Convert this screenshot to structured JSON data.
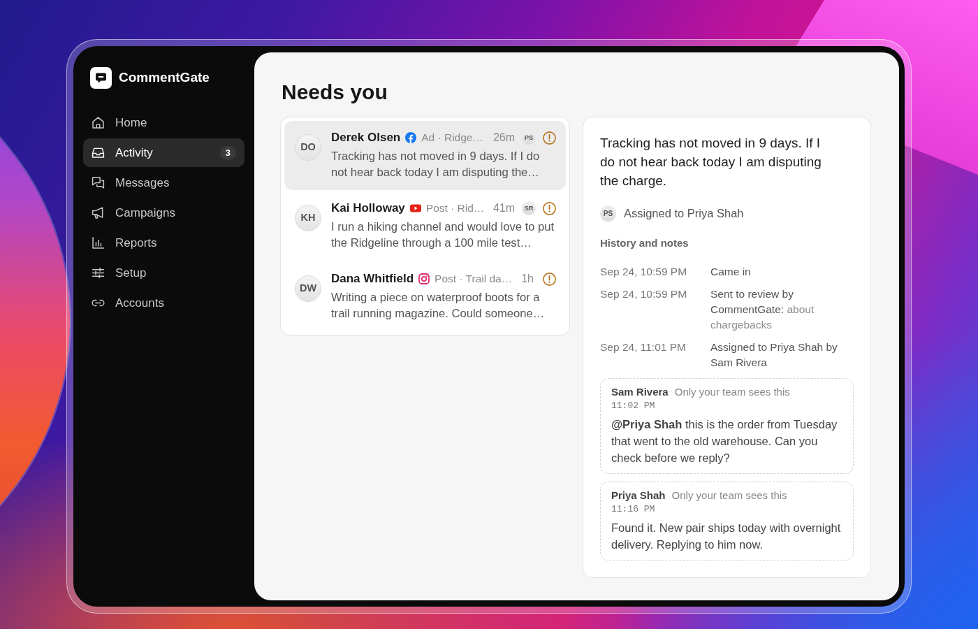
{
  "app": {
    "name": "CommentGate"
  },
  "sidebar": {
    "items": [
      {
        "label": "Home",
        "selected": false
      },
      {
        "label": "Activity",
        "selected": true,
        "badge": "3"
      },
      {
        "label": "Messages",
        "selected": false
      },
      {
        "label": "Campaigns",
        "selected": false
      },
      {
        "label": "Reports",
        "selected": false
      },
      {
        "label": "Setup",
        "selected": false
      },
      {
        "label": "Accounts",
        "selected": false
      }
    ]
  },
  "page": {
    "title": "Needs you"
  },
  "queue": [
    {
      "initials": "DO",
      "name": "Derek Olsen",
      "kind": "facebook",
      "meta": "Ad · Ridge…",
      "time": "26m",
      "assignee": "PS",
      "preview": "Tracking has not moved in 9 days. If I do not hear back today I am disputing the…",
      "selected": true
    },
    {
      "initials": "KH",
      "name": "Kai Holloway",
      "kind": "youtube",
      "meta": "Post · Rid…",
      "time": "41m",
      "assignee": "SR",
      "preview": "I run a hiking channel and would love to put the Ridgeline through a 100 mile test…",
      "selected": false
    },
    {
      "initials": "DW",
      "name": "Dana Whitfield",
      "kind": "instagram",
      "meta": "Post · Trail da…",
      "time": "1h",
      "preview": "Writing a piece on waterproof boots for a trail running magazine. Could someone…",
      "selected": false
    }
  ],
  "detail": {
    "message": "Tracking has not moved in 9 days. If I do not hear back today I am disputing the charge.",
    "assignee_initials": "PS",
    "assigned_text": "Assigned to Priya Shah",
    "history_title": "History and notes",
    "history": [
      {
        "time": "Sep 24, 10:59 PM",
        "text": "Came in"
      },
      {
        "time": "Sep 24, 10:59 PM",
        "text": "Sent to review by CommentGate:",
        "reason": "about chargebacks"
      },
      {
        "time": "Sep 24, 11:01 PM",
        "text": "Assigned to Priya Shah by Sam Rivera"
      }
    ],
    "notes": [
      {
        "author": "Sam Rivera",
        "visibility": "Only your team sees this",
        "time": "11:02 PM",
        "body": "**@Priya Shah** this is the order from Tuesday that went to the old warehouse. Can you check before we reply?"
      },
      {
        "author": "Priya Shah",
        "visibility": "Only your team sees this",
        "time": "11:16 PM",
        "body": "Found it. New pair ships today with overnight delivery. Replying to him now."
      }
    ]
  }
}
